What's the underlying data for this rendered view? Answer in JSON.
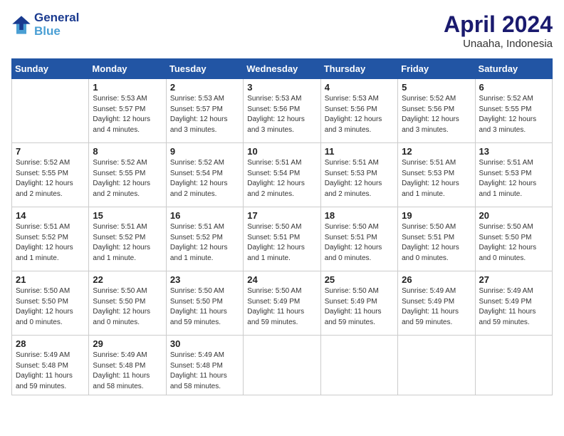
{
  "header": {
    "logo_line1": "General",
    "logo_line2": "Blue",
    "title": "April 2024",
    "subtitle": "Unaaha, Indonesia"
  },
  "weekdays": [
    "Sunday",
    "Monday",
    "Tuesday",
    "Wednesday",
    "Thursday",
    "Friday",
    "Saturday"
  ],
  "weeks": [
    [
      {
        "day": "",
        "sunrise": "",
        "sunset": "",
        "daylight": ""
      },
      {
        "day": "1",
        "sunrise": "Sunrise: 5:53 AM",
        "sunset": "Sunset: 5:57 PM",
        "daylight": "Daylight: 12 hours and 4 minutes."
      },
      {
        "day": "2",
        "sunrise": "Sunrise: 5:53 AM",
        "sunset": "Sunset: 5:57 PM",
        "daylight": "Daylight: 12 hours and 3 minutes."
      },
      {
        "day": "3",
        "sunrise": "Sunrise: 5:53 AM",
        "sunset": "Sunset: 5:56 PM",
        "daylight": "Daylight: 12 hours and 3 minutes."
      },
      {
        "day": "4",
        "sunrise": "Sunrise: 5:53 AM",
        "sunset": "Sunset: 5:56 PM",
        "daylight": "Daylight: 12 hours and 3 minutes."
      },
      {
        "day": "5",
        "sunrise": "Sunrise: 5:52 AM",
        "sunset": "Sunset: 5:56 PM",
        "daylight": "Daylight: 12 hours and 3 minutes."
      },
      {
        "day": "6",
        "sunrise": "Sunrise: 5:52 AM",
        "sunset": "Sunset: 5:55 PM",
        "daylight": "Daylight: 12 hours and 3 minutes."
      }
    ],
    [
      {
        "day": "7",
        "sunrise": "Sunrise: 5:52 AM",
        "sunset": "Sunset: 5:55 PM",
        "daylight": "Daylight: 12 hours and 2 minutes."
      },
      {
        "day": "8",
        "sunrise": "Sunrise: 5:52 AM",
        "sunset": "Sunset: 5:55 PM",
        "daylight": "Daylight: 12 hours and 2 minutes."
      },
      {
        "day": "9",
        "sunrise": "Sunrise: 5:52 AM",
        "sunset": "Sunset: 5:54 PM",
        "daylight": "Daylight: 12 hours and 2 minutes."
      },
      {
        "day": "10",
        "sunrise": "Sunrise: 5:51 AM",
        "sunset": "Sunset: 5:54 PM",
        "daylight": "Daylight: 12 hours and 2 minutes."
      },
      {
        "day": "11",
        "sunrise": "Sunrise: 5:51 AM",
        "sunset": "Sunset: 5:53 PM",
        "daylight": "Daylight: 12 hours and 2 minutes."
      },
      {
        "day": "12",
        "sunrise": "Sunrise: 5:51 AM",
        "sunset": "Sunset: 5:53 PM",
        "daylight": "Daylight: 12 hours and 1 minute."
      },
      {
        "day": "13",
        "sunrise": "Sunrise: 5:51 AM",
        "sunset": "Sunset: 5:53 PM",
        "daylight": "Daylight: 12 hours and 1 minute."
      }
    ],
    [
      {
        "day": "14",
        "sunrise": "Sunrise: 5:51 AM",
        "sunset": "Sunset: 5:52 PM",
        "daylight": "Daylight: 12 hours and 1 minute."
      },
      {
        "day": "15",
        "sunrise": "Sunrise: 5:51 AM",
        "sunset": "Sunset: 5:52 PM",
        "daylight": "Daylight: 12 hours and 1 minute."
      },
      {
        "day": "16",
        "sunrise": "Sunrise: 5:51 AM",
        "sunset": "Sunset: 5:52 PM",
        "daylight": "Daylight: 12 hours and 1 minute."
      },
      {
        "day": "17",
        "sunrise": "Sunrise: 5:50 AM",
        "sunset": "Sunset: 5:51 PM",
        "daylight": "Daylight: 12 hours and 1 minute."
      },
      {
        "day": "18",
        "sunrise": "Sunrise: 5:50 AM",
        "sunset": "Sunset: 5:51 PM",
        "daylight": "Daylight: 12 hours and 0 minutes."
      },
      {
        "day": "19",
        "sunrise": "Sunrise: 5:50 AM",
        "sunset": "Sunset: 5:51 PM",
        "daylight": "Daylight: 12 hours and 0 minutes."
      },
      {
        "day": "20",
        "sunrise": "Sunrise: 5:50 AM",
        "sunset": "Sunset: 5:50 PM",
        "daylight": "Daylight: 12 hours and 0 minutes."
      }
    ],
    [
      {
        "day": "21",
        "sunrise": "Sunrise: 5:50 AM",
        "sunset": "Sunset: 5:50 PM",
        "daylight": "Daylight: 12 hours and 0 minutes."
      },
      {
        "day": "22",
        "sunrise": "Sunrise: 5:50 AM",
        "sunset": "Sunset: 5:50 PM",
        "daylight": "Daylight: 12 hours and 0 minutes."
      },
      {
        "day": "23",
        "sunrise": "Sunrise: 5:50 AM",
        "sunset": "Sunset: 5:50 PM",
        "daylight": "Daylight: 11 hours and 59 minutes."
      },
      {
        "day": "24",
        "sunrise": "Sunrise: 5:50 AM",
        "sunset": "Sunset: 5:49 PM",
        "daylight": "Daylight: 11 hours and 59 minutes."
      },
      {
        "day": "25",
        "sunrise": "Sunrise: 5:50 AM",
        "sunset": "Sunset: 5:49 PM",
        "daylight": "Daylight: 11 hours and 59 minutes."
      },
      {
        "day": "26",
        "sunrise": "Sunrise: 5:49 AM",
        "sunset": "Sunset: 5:49 PM",
        "daylight": "Daylight: 11 hours and 59 minutes."
      },
      {
        "day": "27",
        "sunrise": "Sunrise: 5:49 AM",
        "sunset": "Sunset: 5:49 PM",
        "daylight": "Daylight: 11 hours and 59 minutes."
      }
    ],
    [
      {
        "day": "28",
        "sunrise": "Sunrise: 5:49 AM",
        "sunset": "Sunset: 5:48 PM",
        "daylight": "Daylight: 11 hours and 59 minutes."
      },
      {
        "day": "29",
        "sunrise": "Sunrise: 5:49 AM",
        "sunset": "Sunset: 5:48 PM",
        "daylight": "Daylight: 11 hours and 58 minutes."
      },
      {
        "day": "30",
        "sunrise": "Sunrise: 5:49 AM",
        "sunset": "Sunset: 5:48 PM",
        "daylight": "Daylight: 11 hours and 58 minutes."
      },
      {
        "day": "",
        "sunrise": "",
        "sunset": "",
        "daylight": ""
      },
      {
        "day": "",
        "sunrise": "",
        "sunset": "",
        "daylight": ""
      },
      {
        "day": "",
        "sunrise": "",
        "sunset": "",
        "daylight": ""
      },
      {
        "day": "",
        "sunrise": "",
        "sunset": "",
        "daylight": ""
      }
    ]
  ]
}
